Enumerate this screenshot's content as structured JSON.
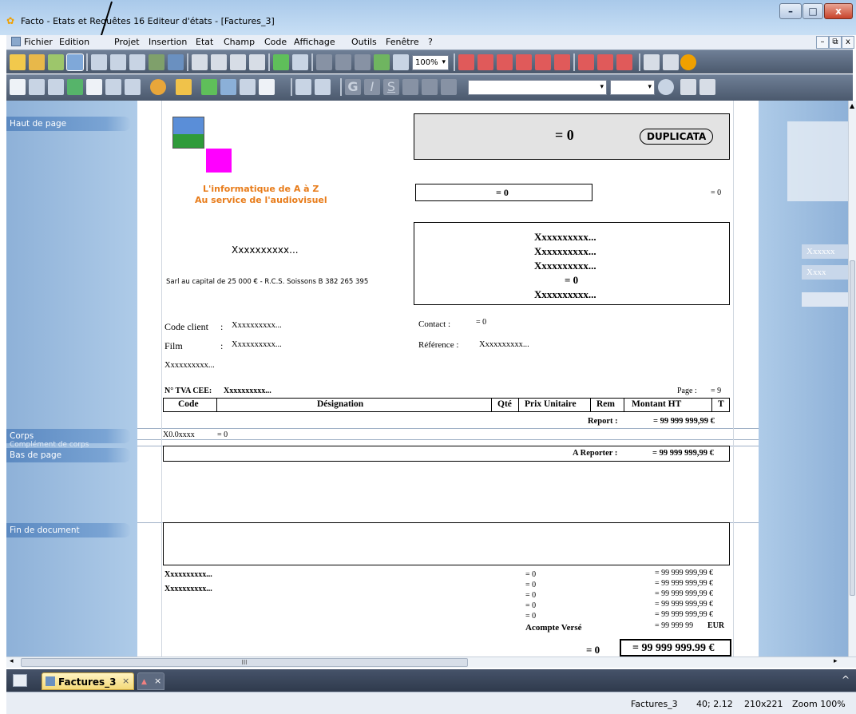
{
  "window": {
    "title": "Facto - Etats et Requêtes 16 Editeur d'états - [Factures_3]",
    "minimize": "–",
    "maximize": "□",
    "close": "x"
  },
  "menu": {
    "items": [
      "Fichier",
      "Edition",
      "Projet",
      "Insertion",
      "Etat",
      "Champ",
      "Code",
      "Affichage",
      "Outils",
      "Fenêtre",
      "?"
    ],
    "mdi_minimize": "–",
    "mdi_restore": "⧉",
    "mdi_close": "x"
  },
  "toolbar": {
    "zoom": "100%"
  },
  "bands": {
    "header": "Haut de page",
    "body": "Corps",
    "body_complement": "Complément de corps",
    "footer": "Bas de page",
    "end": "Fin de document"
  },
  "report": {
    "duplicata_formula": "= 0",
    "duplicata_label": "DUPLICATA",
    "company_line1": "L'informatique de A à Z",
    "company_line2": "Au service de l'audiovisuel",
    "num_formula": "= 0",
    "num_right": "= 0",
    "company_name": "Xxxxxxxxxx...",
    "legal": "Sarl au capital de 25 000 € - R.C.S. Soissons B 382 265 395",
    "address_lines": [
      "Xxxxxxxxxx...",
      "Xxxxxxxxxx...",
      "Xxxxxxxxxx...",
      "= 0",
      "Xxxxxxxxxx..."
    ],
    "code_client_label": "Code client",
    "colon": ":",
    "code_client_value": "Xxxxxxxxxx...",
    "contact_label": "Contact :",
    "contact_value": "= 0",
    "film_label": "Film",
    "film_value": "Xxxxxxxxxx...",
    "reference_label": "Référence :",
    "reference_value": "Xxxxxxxxxx...",
    "extra_line": "Xxxxxxxxxx...",
    "tva_label": "N° TVA CEE:",
    "tva_value": "Xxxxxxxxxx...",
    "page_label": "Page :",
    "page_value": "= 9",
    "columns": [
      "Code",
      "Désignation",
      "Qté",
      "Prix Unitaire",
      "Rem",
      "Montant HT",
      "T"
    ],
    "report_label": "Report :",
    "report_value": "= 99 999 999,99 €",
    "body_code": "X0.0xxxx",
    "body_formula": "= 0",
    "areporter_label": "A Reporter :",
    "areporter_value": "= 99 999 999,99 €",
    "totals_left": [
      "Xxxxxxxxxx...",
      "Xxxxxxxxxx..."
    ],
    "totals_mid": [
      "= 0",
      "= 0",
      "= 0",
      "= 0",
      "= 0"
    ],
    "totals_right": [
      "= 99 999 999,99 €",
      "= 99 999 999,99 €",
      "= 99 999 999,99 €",
      "= 99 999 999,99 €",
      "= 99 999 999,99 €"
    ],
    "acompte_label": "Acompte Versé",
    "acompte_value": "= 99 999 99",
    "acompte_currency": "EUR",
    "final_formula": "= 0",
    "final_total": "= 99 999 999.99 €"
  },
  "right_pane": {
    "field1": "Xxxxxx",
    "field2": "Xxxx"
  },
  "tabs": {
    "active": "Factures_3",
    "close": "×"
  },
  "status": {
    "doc": "Factures_3",
    "coords": "40; 2.12",
    "size": "210x221",
    "zoom": "Zoom 100%"
  },
  "scroll": {
    "h_thumb": "III"
  }
}
